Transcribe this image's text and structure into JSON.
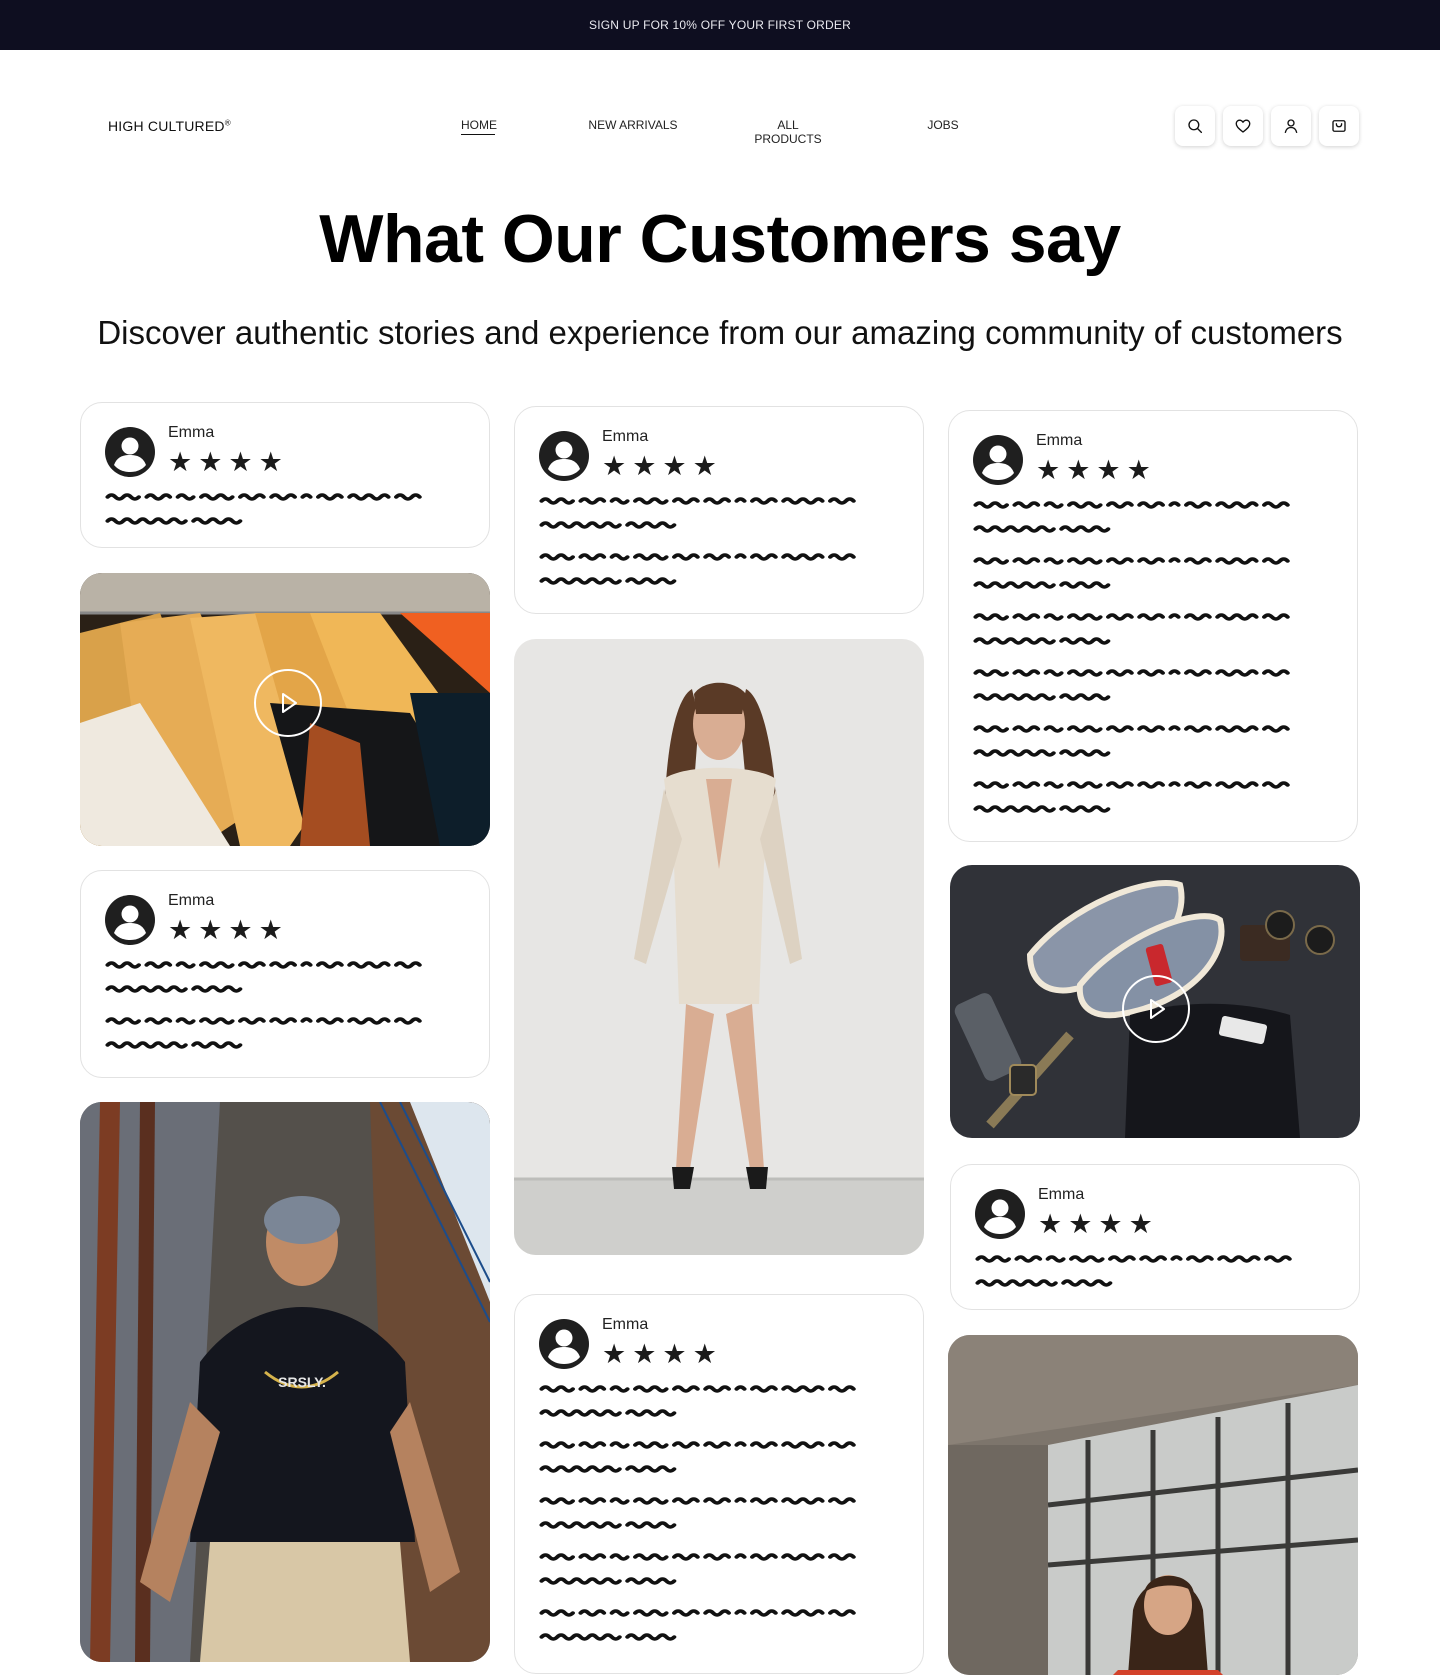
{
  "promo": {
    "text": "SIGN UP FOR 10% OFF YOUR FIRST ORDER"
  },
  "nav": {
    "logo": "HIGH CULTURED",
    "logo_mark": "®",
    "items": [
      {
        "label": "HOME",
        "active": true
      },
      {
        "label": "NEW ARRIVALS",
        "active": false
      },
      {
        "label": "ALL PRODUCTS",
        "active": false
      },
      {
        "label": "JOBS",
        "active": false
      }
    ],
    "icons": [
      "search-icon",
      "heart-icon",
      "user-icon",
      "cart-icon"
    ]
  },
  "hero": {
    "title": "What Our Customers say",
    "subtitle": "Discover authentic stories and experience from our amazing community of customers"
  },
  "reviews": [
    {
      "name": "Emma",
      "stars": "★★★★",
      "rating": 4
    },
    {
      "name": "Emma",
      "stars": "★★★★",
      "rating": 4
    },
    {
      "name": "Emma",
      "stars": "★★★★",
      "rating": 4
    },
    {
      "name": "Emma",
      "stars": "★★★★",
      "rating": 4
    },
    {
      "name": "Emma",
      "stars": "★★★★",
      "rating": 4
    },
    {
      "name": "Emma",
      "stars": "★★★★",
      "rating": 4
    }
  ],
  "colors": {
    "promo_bg": "#0e0e20",
    "text": "#111111",
    "card_border": "#e2e2e2"
  }
}
